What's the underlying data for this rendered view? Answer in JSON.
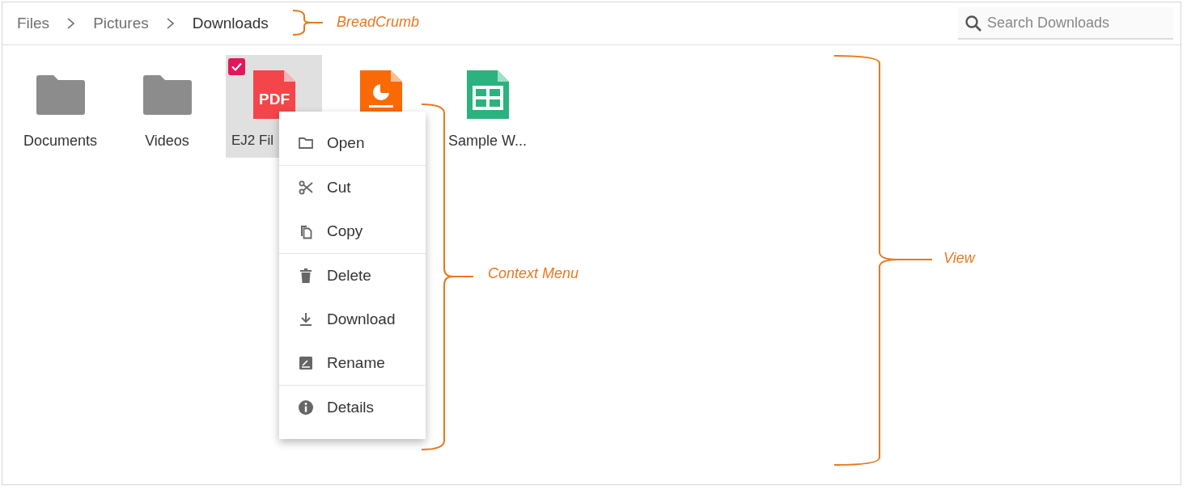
{
  "breadcrumb": [
    {
      "label": "Files",
      "current": false
    },
    {
      "label": "Pictures",
      "current": false
    },
    {
      "label": "Downloads",
      "current": true
    }
  ],
  "search": {
    "placeholder": "Search Downloads"
  },
  "files": [
    {
      "name": "Documents",
      "kind": "folder",
      "selected": false
    },
    {
      "name": "Videos",
      "kind": "folder",
      "selected": false
    },
    {
      "name": "EJ2 Fil",
      "kind": "pdf",
      "badge": "PDF",
      "selected": true
    },
    {
      "kind": "presentation",
      "selected": false
    },
    {
      "name": "Sample W...",
      "kind": "spreadsheet",
      "selected": false
    }
  ],
  "context_menu": {
    "groups": [
      [
        {
          "label": "Open"
        }
      ],
      [
        {
          "label": "Cut"
        },
        {
          "label": "Copy"
        }
      ],
      [
        {
          "label": "Delete"
        },
        {
          "label": "Download"
        },
        {
          "label": "Rename"
        }
      ],
      [
        {
          "label": "Details"
        }
      ]
    ]
  },
  "annotations": [
    {
      "label": "BreadCrumb"
    },
    {
      "label": "Context Menu"
    },
    {
      "label": "View"
    }
  ]
}
